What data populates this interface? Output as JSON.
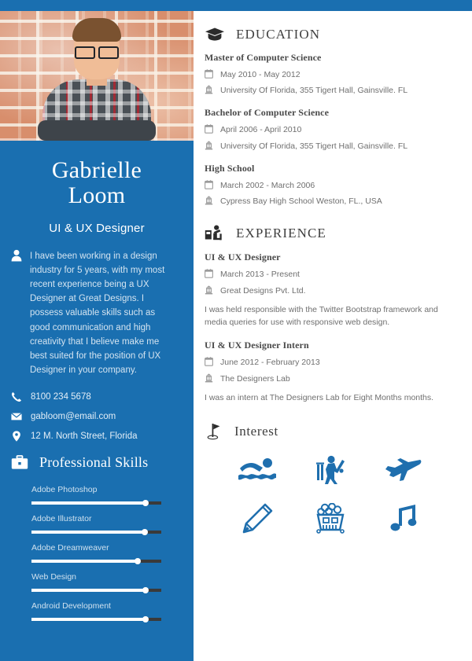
{
  "theme": {
    "accent_blue": "#1a6fb0",
    "bar_track": "#3a3a3a",
    "heading_gray": "#3f3f3f",
    "body_gray": "#6f6f6f"
  },
  "profile": {
    "name_line1": "Gabrielle",
    "name_line2": "Loom",
    "job_title": "UI & UX Designer",
    "bio": "I have been working in a design industry for 5 years, with my most recent experience being a UX Designer at Great Designs. I possess valuable skills such as good communication and high creativity that I believe make me best suited for the position of UX Designer in your company.",
    "photo_alt": "profile-photo"
  },
  "contact": {
    "phone": "8100 234 5678",
    "email": "gabloom@email.com",
    "address": "12 M. North Street, Florida"
  },
  "skills": {
    "title": "Professional Skills",
    "items": [
      {
        "name": "Adobe Photoshop",
        "level": 88
      },
      {
        "name": "Adobe Illustrator",
        "level": 87
      },
      {
        "name": "Adobe Dreamweaver",
        "level": 82
      },
      {
        "name": "Web Design",
        "level": 88
      },
      {
        "name": "Android Development",
        "level": 88
      }
    ]
  },
  "education": {
    "title": "EDUCATION",
    "entries": [
      {
        "degree": "Master of Computer Science",
        "dates": "May 2010 - May 2012",
        "institution": "University Of Florida, 355 Tigert Hall, Gainsville. FL"
      },
      {
        "degree": "Bachelor of Computer Science",
        "dates": "April 2006 - April 2010",
        "institution": "University Of Florida, 355 Tigert Hall, Gainsville. FL"
      },
      {
        "degree": "High School",
        "dates": "March 2002 - March 2006",
        "institution": "Cypress Bay High School Weston, FL., USA"
      }
    ]
  },
  "experience": {
    "title": "EXPERIENCE",
    "entries": [
      {
        "role": "UI & UX Designer",
        "dates": "March 2013 - Present",
        "company": "Great Designs Pvt. Ltd.",
        "description": " I was held responsible with the Twitter Bootstrap framework and media queries for use with responsive web design."
      },
      {
        "role": "UI & UX Designer Intern",
        "dates": "June 2012 - February 2013",
        "company": "The Designers Lab",
        "description": "I was an intern at The Designers Lab for Eight Months months."
      }
    ]
  },
  "interest": {
    "title": "Interest",
    "icons": [
      "swimming-icon",
      "cricket-icon",
      "airplane-icon",
      "pencil-icon",
      "popcorn-icon",
      "music-note-icon"
    ]
  }
}
